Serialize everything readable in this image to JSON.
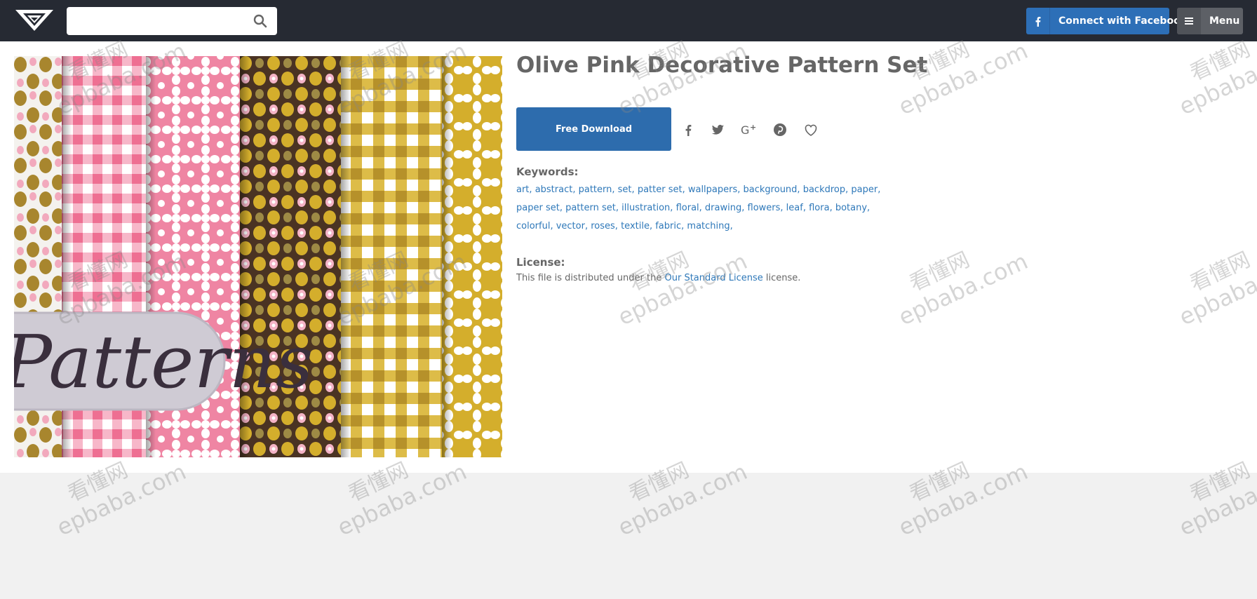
{
  "header": {
    "search": {
      "placeholder": "",
      "value": ""
    },
    "facebook_label": "Connect with Facebook",
    "menu_label": "Menu"
  },
  "product": {
    "title": "Olive Pink Decorative Pattern Set",
    "preview_banner_text": "Patterns",
    "download_label": "Free Download",
    "share_icons": [
      "facebook-icon",
      "twitter-icon",
      "google-plus-icon",
      "pinterest-icon",
      "heart-icon"
    ],
    "keywords_label": "Keywords:",
    "keywords": [
      "art",
      "abstract",
      "pattern",
      "set",
      "patter set",
      "wallpapers",
      "background",
      "backdrop",
      "paper",
      "paper set",
      "pattern set",
      "illustration",
      "floral",
      "drawing",
      "flowers",
      "leaf",
      "flora",
      "botany",
      "colorful",
      "vector",
      "roses",
      "textile",
      "fabric",
      "matching"
    ],
    "license_label": "License:",
    "license_prefix": "This file is distributed under the",
    "license_link": "Our Standard License",
    "license_suffix": "license."
  },
  "watermark": {
    "line1": "看懂网",
    "line2": "epbaba.com"
  },
  "colors": {
    "topbar": "#262a33",
    "facebook": "#2d6fb7",
    "download": "#2d6cad",
    "link": "#2e78b9",
    "pink": "#ef85a3",
    "mustard": "#d4ae2c",
    "brown": "#4a3323"
  }
}
